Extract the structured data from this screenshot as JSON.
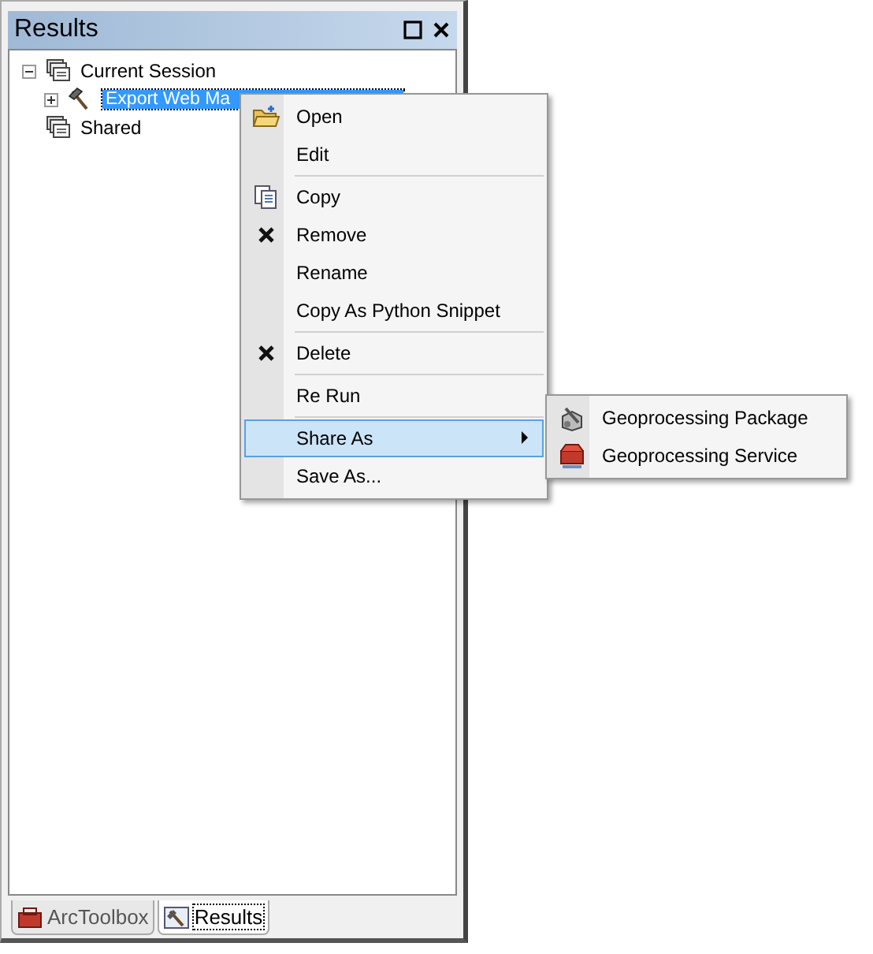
{
  "panel": {
    "title": "Results"
  },
  "tree": [
    {
      "label": "Current Session",
      "expanded": true,
      "selected": false,
      "children": [
        {
          "label": "Export Web Ma",
          "expanded": false,
          "selected": true
        }
      ]
    },
    {
      "label": "Shared",
      "selected": false
    }
  ],
  "context_menu": [
    {
      "kind": "item",
      "label": "Open",
      "selected": false
    },
    {
      "kind": "item",
      "label": "Edit",
      "selected": false
    },
    {
      "kind": "separator"
    },
    {
      "kind": "item",
      "label": "Copy",
      "selected": false
    },
    {
      "kind": "item",
      "label": "Remove",
      "selected": false
    },
    {
      "kind": "item",
      "label": "Rename",
      "selected": false
    },
    {
      "kind": "item",
      "label": "Copy As Python Snippet",
      "selected": false
    },
    {
      "kind": "separator"
    },
    {
      "kind": "item",
      "label": "Delete",
      "selected": false
    },
    {
      "kind": "separator"
    },
    {
      "kind": "item",
      "label": "Re Run",
      "selected": false
    },
    {
      "kind": "separator"
    },
    {
      "kind": "submenu",
      "label": "Share As",
      "selected": true
    },
    {
      "kind": "item",
      "label": "Save As...",
      "selected": false
    }
  ],
  "submenu": [
    {
      "label": "Geoprocessing Package"
    },
    {
      "label": "Geoprocessing Service"
    }
  ],
  "bottom_tabs": [
    {
      "label": "ArcToolbox",
      "selected": false
    },
    {
      "label": "Results",
      "selected": true
    }
  ]
}
